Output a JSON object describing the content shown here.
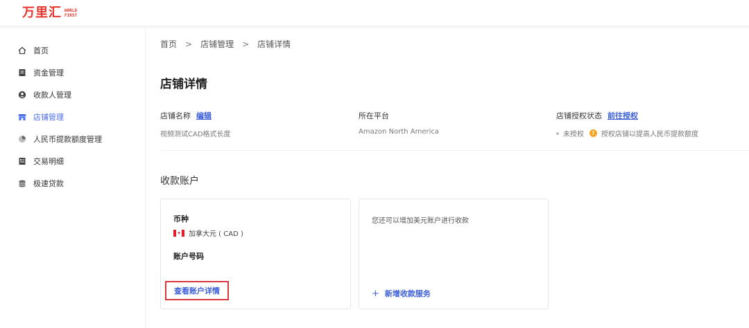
{
  "logo": {
    "cn": "万里汇",
    "en_line1": "WORLD",
    "en_line2": "FIRST"
  },
  "sidebar": {
    "items": [
      {
        "label": "首页",
        "icon": "home-icon",
        "active": false
      },
      {
        "label": "资金管理",
        "icon": "document-icon",
        "active": false
      },
      {
        "label": "收款人管理",
        "icon": "user-icon",
        "active": false
      },
      {
        "label": "店铺管理",
        "icon": "store-icon",
        "active": true
      },
      {
        "label": "人民币提款额度管理",
        "icon": "quota-icon",
        "active": false
      },
      {
        "label": "交易明细",
        "icon": "list-icon",
        "active": false
      },
      {
        "label": "极速贷款",
        "icon": "loan-icon",
        "active": false
      }
    ]
  },
  "breadcrumb": {
    "items": [
      "首页",
      "店铺管理",
      "店铺详情"
    ],
    "separator": ">"
  },
  "page": {
    "title": "店铺详情"
  },
  "info": {
    "store_name_label": "店铺名称",
    "store_name_edit": "编辑",
    "store_name_value": "视频测试CAD格式长度",
    "platform_label": "所在平台",
    "platform_value": "Amazon North America",
    "auth_label": "店铺授权状态",
    "auth_link": "前往授权",
    "auth_status": "未授权",
    "auth_tip": "授权店铺以提高人民币提款额度"
  },
  "accounts": {
    "section_title": "收款账户",
    "card1": {
      "currency_label": "币种",
      "currency_value": "加拿大元 ( CAD )",
      "account_label": "账户号码",
      "view_link": "查看账户详情"
    },
    "card2": {
      "text": "您还可以增加美元账户进行收款",
      "add_plus": "+",
      "add_link": "新增收款服务"
    }
  },
  "colors": {
    "brand": "#e8332a",
    "accent": "#3d5fd8",
    "active_nav": "#4a6ef0",
    "highlight_box": "#d9363e",
    "warning": "#f5a623"
  }
}
